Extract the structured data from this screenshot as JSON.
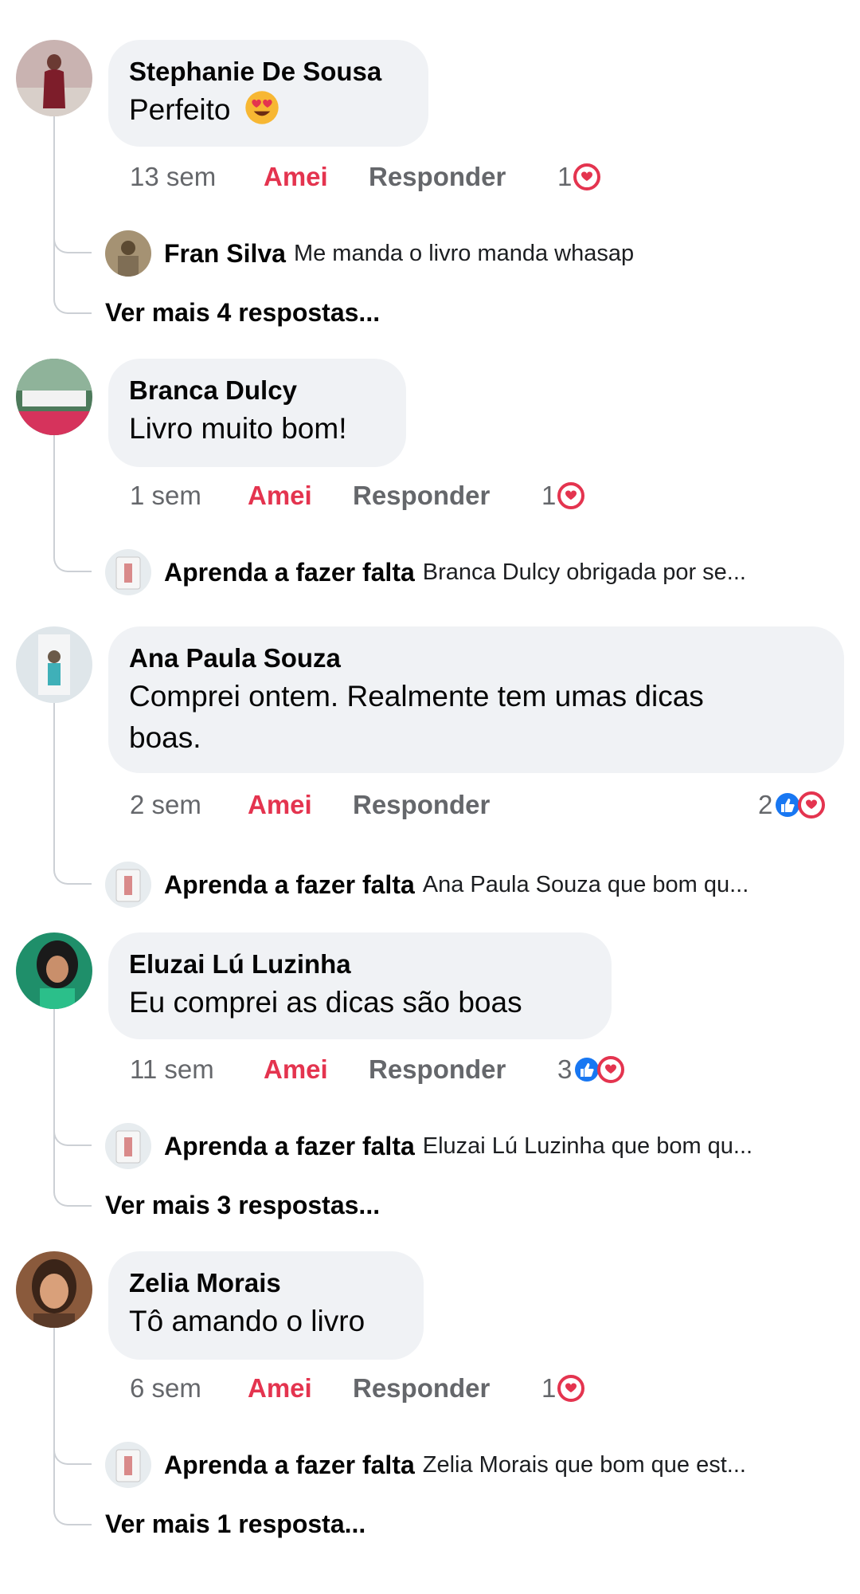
{
  "comments": [
    {
      "author": "Stephanie De Sousa",
      "text": "Perfeito",
      "emoji_icon": "heart-eyes-emoji-icon",
      "time": "13 sem",
      "reacted_label": "Amei",
      "reply_label": "Responder",
      "reaction_count": "1",
      "reactions": [
        "love"
      ],
      "reply": {
        "author": "Fran Silva",
        "text": "Me manda o livro  manda whasap"
      },
      "more_replies": "Ver mais 4 respostas..."
    },
    {
      "author": "Branca Dulcy",
      "text": "Livro muito bom!",
      "time": "1 sem",
      "reacted_label": "Amei",
      "reply_label": "Responder",
      "reaction_count": "1",
      "reactions": [
        "love"
      ],
      "reply": {
        "author": "Aprenda a fazer falta",
        "text": "Branca Dulcy obrigada por se..."
      }
    },
    {
      "author": "Ana Paula Souza",
      "text_line1": "Comprei ontem. Realmente tem umas dicas",
      "text_line2": "boas.",
      "time": "2 sem",
      "reacted_label": "Amei",
      "reply_label": "Responder",
      "reaction_count": "2",
      "reactions": [
        "like",
        "love"
      ],
      "reply": {
        "author": "Aprenda a fazer falta",
        "text": "Ana Paula Souza que bom qu..."
      }
    },
    {
      "author": "Eluzai Lú Luzinha",
      "text": "Eu comprei as dicas são boas",
      "time": "11 sem",
      "reacted_label": "Amei",
      "reply_label": "Responder",
      "reaction_count": "3",
      "reactions": [
        "like",
        "love"
      ],
      "reply": {
        "author": "Aprenda a fazer falta",
        "text": "Eluzai Lú Luzinha que bom qu..."
      },
      "more_replies": "Ver mais 3 respostas..."
    },
    {
      "author": "Zelia Morais",
      "text": "Tô amando o livro",
      "time": "6 sem",
      "reacted_label": "Amei",
      "reply_label": "Responder",
      "reaction_count": "1",
      "reactions": [
        "love"
      ],
      "reply": {
        "author": "Aprenda a fazer falta",
        "text": "Zelia Morais que bom que est..."
      },
      "more_replies": "Ver mais 1 resposta..."
    }
  ],
  "colors": {
    "bubble": "#f0f2f5",
    "love_red": "#e4344f",
    "like_blue": "#1877f2",
    "muted_text": "#65676b",
    "thread_line": "#ccd0d5"
  }
}
